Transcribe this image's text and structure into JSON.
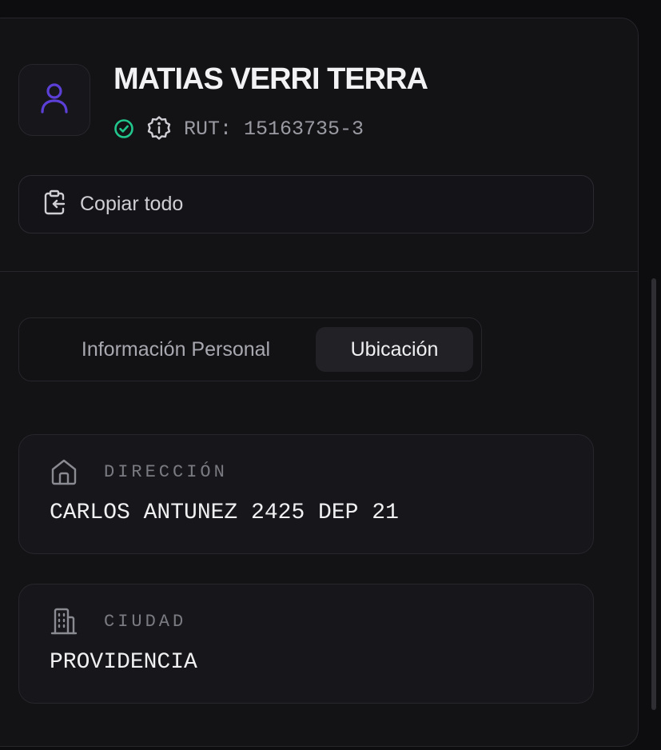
{
  "profile": {
    "name": "MATIAS VERRI TERRA",
    "rut": "RUT: 15163735-3",
    "avatar_icon": "user-icon",
    "verified_icon": "check-circle-icon",
    "info_icon": "info-badge-icon"
  },
  "actions": {
    "copy_all_label": "Copiar todo",
    "copy_icon": "clipboard-copy-icon"
  },
  "tabs": [
    {
      "label": "Información Personal",
      "active": false
    },
    {
      "label": "Ubicación",
      "active": true
    }
  ],
  "location": {
    "address": {
      "label": "DIRECCIÓN",
      "value": "CARLOS ANTUNEZ 2425 DEP 21",
      "icon": "home-icon"
    },
    "city": {
      "label": "CIUDAD",
      "value": "PROVIDENCIA",
      "icon": "building-icon"
    }
  },
  "colors": {
    "background": "#0d0d0f",
    "panel": "#131316",
    "accent_avatar": "#5b3fd6",
    "verified": "#22c58b",
    "text_primary": "#f0f0f2",
    "text_muted": "#7a7a82"
  }
}
